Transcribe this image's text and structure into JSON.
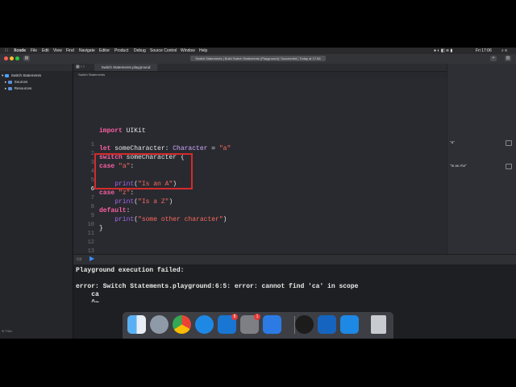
{
  "menubar": {
    "apple": "",
    "items": [
      "Xcode",
      "File",
      "Edit",
      "View",
      "Find",
      "Navigate",
      "Editor",
      "Product",
      "Debug",
      "Source Control",
      "Window",
      "Help"
    ],
    "clock": "Fri 17:06"
  },
  "toolbar": {
    "status": "Switch Statements | Build Switch Statements (Playground): Succeeded | Today at 17:06"
  },
  "navigator": {
    "project": "Switch Statements",
    "items": [
      "Sources",
      "Resources"
    ]
  },
  "editor": {
    "tab_label": "Switch Statements.playground",
    "jumpbar": "Switch Statements",
    "line_numbers": [
      "1",
      "2",
      "3",
      "4",
      "5",
      "6",
      "7",
      "8",
      "9",
      "10",
      "11",
      "12",
      "13",
      "14"
    ],
    "lines": [
      "import UIKit",
      "",
      "let someCharacter: Character = \"a\"",
      "switch someCharacter {",
      "case \"a\":",
      "",
      "    print(\"Is an A\")",
      "case \"z\":",
      "    print(\"Is a Z\")",
      "default:",
      "    print(\"some other character\")",
      "}",
      "",
      ""
    ]
  },
  "results": [
    "\"a\"",
    "\"Is an A\\n\""
  ],
  "console": {
    "lines": [
      "Playground execution failed:",
      "",
      "error: Switch Statements.playground:6:5: error: cannot find 'ca' in scope",
      "    ca",
      "    ^~"
    ]
  },
  "nav_filter": "Filter",
  "dock": {
    "icons": [
      "finder-icon",
      "launchpad-icon",
      "chrome-icon",
      "safari-icon",
      "app-store-icon",
      "system-preferences-icon",
      "xcode-icon",
      "obs-icon",
      "teamviewer-icon",
      "preview-icon",
      "trash-icon"
    ],
    "badges": {
      "app_store": "8",
      "system_preferences": "1"
    }
  }
}
